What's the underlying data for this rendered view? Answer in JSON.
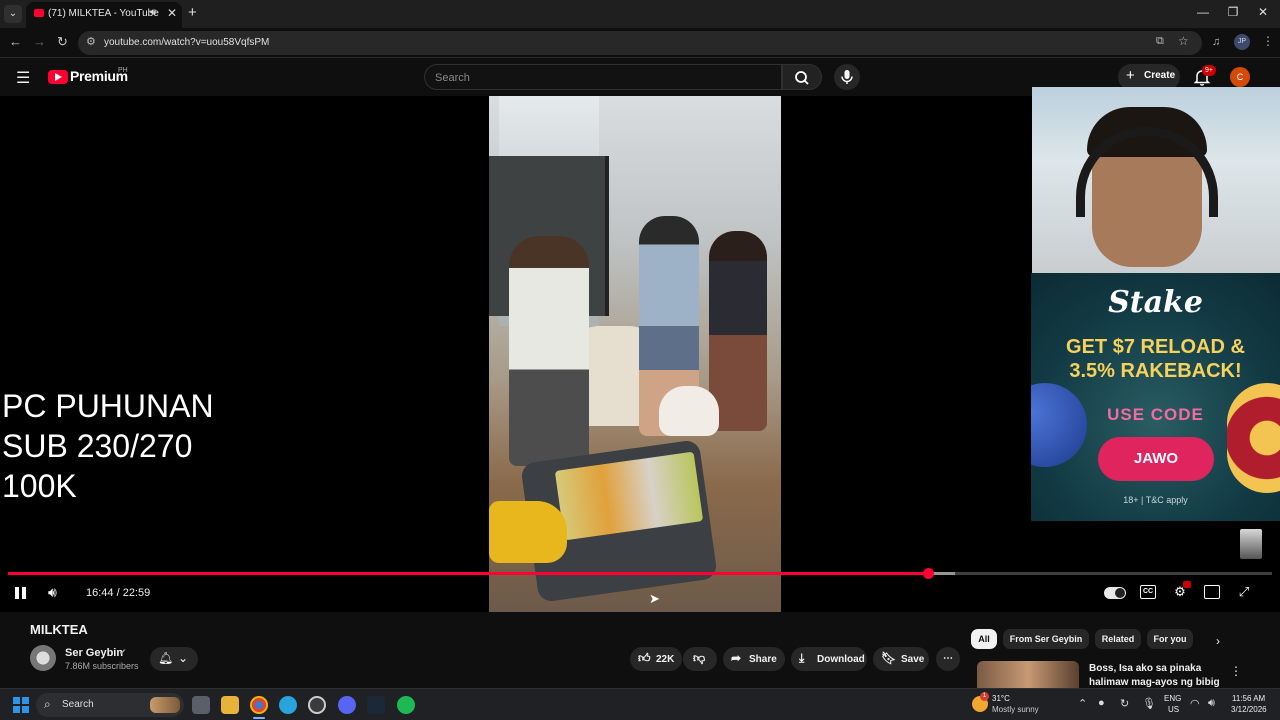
{
  "browser": {
    "tab_title": "(71) MILKTEA - YouTube",
    "url": "youtube.com/watch?v=uou58VqfsPM",
    "window_controls": [
      "minimize",
      "restore",
      "close"
    ]
  },
  "masthead": {
    "logo_text": "Premium",
    "logo_region": "PH",
    "search_placeholder": "Search",
    "create_label": "Create",
    "notification_count": "9+",
    "account_initial": "C"
  },
  "player": {
    "overlay_lines": [
      "PC PUHUNAN",
      "SUB 230/270",
      "100K"
    ],
    "current_time": "16:44",
    "duration": "22:59",
    "time_display": "16:44 / 22:59",
    "played_fraction": 0.728,
    "buffered_fraction": 0.749,
    "cc_label": "CC"
  },
  "ad": {
    "brand": "Stake",
    "headline_line1": "GET $7 RELOAD &",
    "headline_line2": "3.5% RAKEBACK!",
    "use_code_label": "USE CODE",
    "code": "JAWO",
    "fine_print": "18+ | T&C apply"
  },
  "video": {
    "title": "MILKTEA",
    "channel_name": "Ser Geybin",
    "subscribers": "7.86M subscribers",
    "like_count": "22K",
    "share_label": "Share",
    "download_label": "Download",
    "save_label": "Save"
  },
  "chips": [
    "All",
    "From Ser Geybin",
    "Related",
    "For you"
  ],
  "related": {
    "title_line1": "Boss, Isa ako sa pinaka",
    "title_line2": "halimaw mag-ayos ng bibig"
  },
  "taskbar": {
    "search_label": "Search",
    "weather_temp": "31°C",
    "weather_desc": "Mostly sunny",
    "weather_badge": "1",
    "lang_line1": "ENG",
    "lang_line2": "US",
    "time": "11:56 AM",
    "date": "3/12/2026"
  },
  "colors": {
    "youtube_red": "#ff0033",
    "ad_accent": "#e0245e",
    "ad_gold": "#f6d15b"
  }
}
